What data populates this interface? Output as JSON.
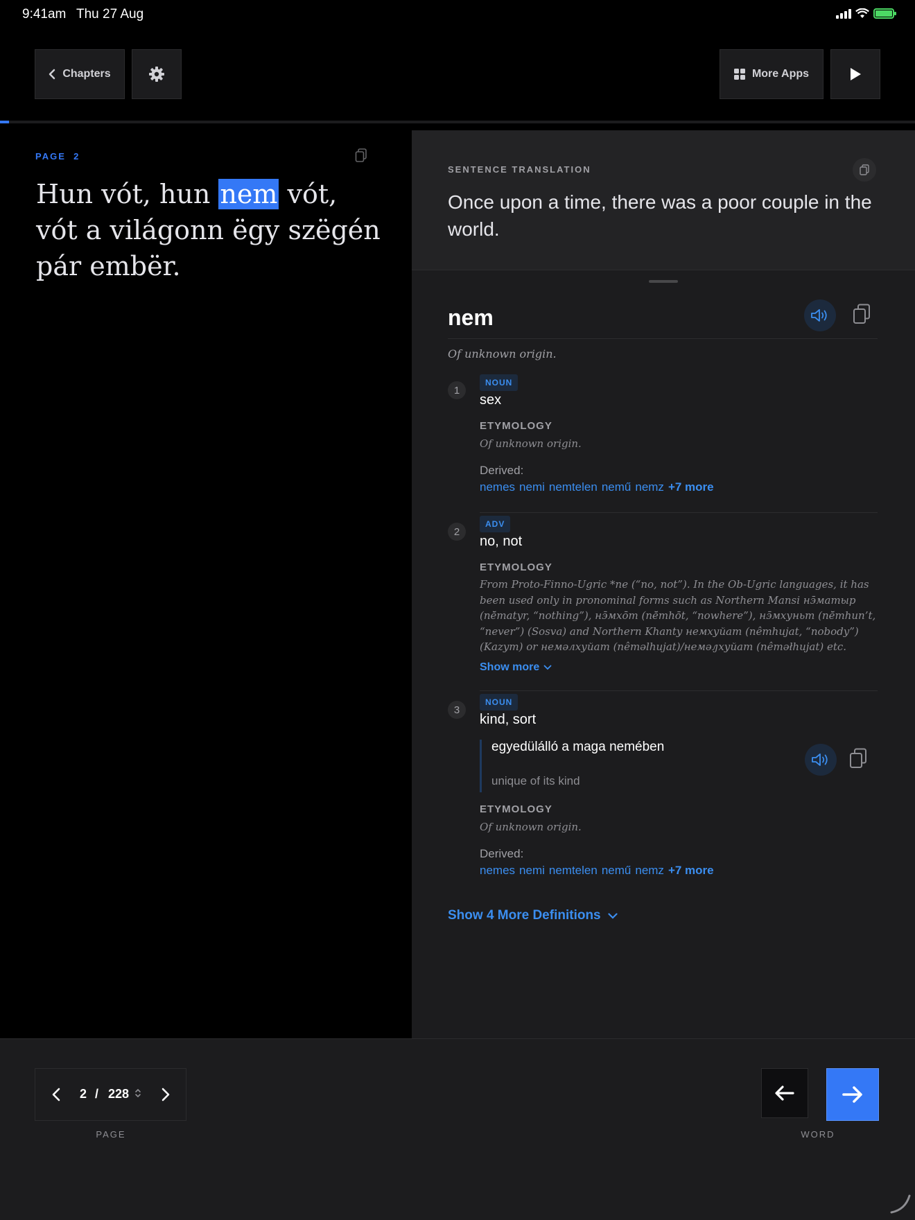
{
  "status": {
    "time": "9:41am",
    "date": "Thu 27 Aug"
  },
  "toolbar": {
    "chapters_label": "Chapters",
    "more_apps_label": "More Apps",
    "reading_progress_percent": 1
  },
  "reader": {
    "page_label": "PAGE",
    "page_number": "2",
    "passage": {
      "before": "Hun vót, hun ",
      "highlight": "nem",
      "after": " vót, vót a világonn ëgy szëgén pár embër."
    }
  },
  "translation": {
    "label": "SENTENCE TRANSLATION",
    "text": "Once upon a time, there was a poor couple in the world."
  },
  "word": {
    "headword": "nem",
    "origin": "Of unknown origin.",
    "definitions": [
      {
        "num": "1",
        "pos": "NOUN",
        "meaning": "sex",
        "etymology_label": "ETYMOLOGY",
        "etymology": "Of unknown origin.",
        "derived_label": "Derived:",
        "derived": [
          "nemes",
          "nemi",
          "nemtelen",
          "nemű",
          "nemz"
        ],
        "derived_more": "+7 more"
      },
      {
        "num": "2",
        "pos": "ADV",
        "meaning": "no, not",
        "etymology_label": "ETYMOLOGY",
        "etymology": "From Proto-Finno-Ugric *ne (“no, not”). In the Ob-Ugric languages, it has been used only in pronominal forms such as Northern Mansi нэ̄матыр (nē̆matyr, “nothing”), нэ̄мхо̄т (nē̆mhōt, “nowhere”), нэ̄мхуньт (nē̆mhun’t, “never”) (Sosva) and Northern Khanty немхуйат (nêmhujat, “nobody”) (Kazym) or немәлхуйат (nêməlhujat)/немәԓхуйат (nêməłhujat) etc.",
        "show_more": "Show more"
      },
      {
        "num": "3",
        "pos": "NOUN",
        "meaning": "kind, sort",
        "example_source": "egyedülálló a maga nemében",
        "example_translation": "unique of its kind",
        "etymology_label": "ETYMOLOGY",
        "etymology": "Of unknown origin.",
        "derived_label": "Derived:",
        "derived": [
          "nemes",
          "nemi",
          "nemtelen",
          "nemű",
          "nemz"
        ],
        "derived_more": "+7 more"
      }
    ],
    "show_more_definitions": "Show 4 More Definitions"
  },
  "pager": {
    "current": "2",
    "separator": "/",
    "total": "228",
    "caption": "PAGE"
  },
  "word_nav": {
    "caption": "WORD"
  },
  "colors": {
    "accent": "#3478f6",
    "link": "#3b8ef0",
    "battery": "#4cd964"
  }
}
